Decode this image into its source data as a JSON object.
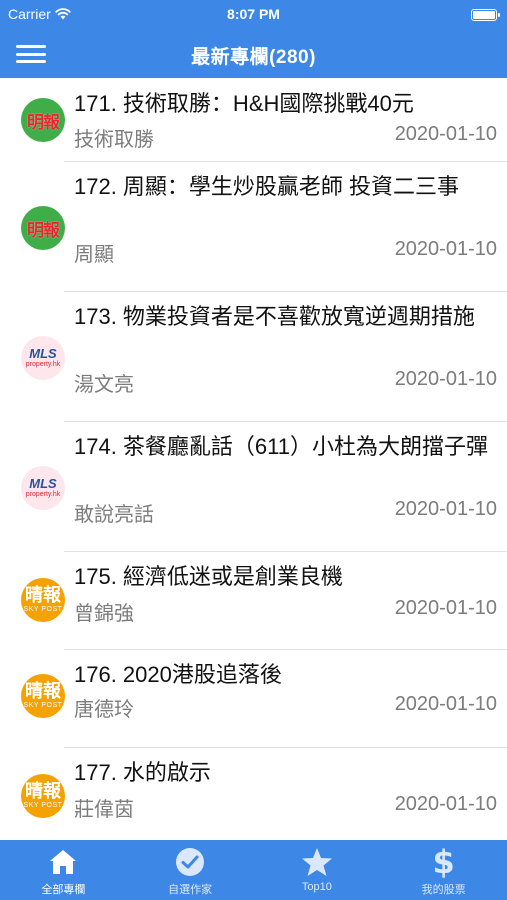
{
  "status_bar": {
    "carrier": "Carrier",
    "time": "8:07 PM"
  },
  "nav": {
    "title": "最新專欄(280)"
  },
  "articles": [
    {
      "logo": "mingpao",
      "logo_text": "明報",
      "headline": "171. 技術取勝：H&H國際挑戰40元",
      "author": "技術取勝",
      "date": "2020-01-10"
    },
    {
      "logo": "mingpao",
      "logo_text": "明報",
      "headline": "172. 周顯：學生炒股贏老師 投資二三事",
      "author": "周顯",
      "date": "2020-01-10"
    },
    {
      "logo": "mls",
      "logo_text": "MLS",
      "logo_sub": "property.hk",
      "headline": "173. 物業投資者是不喜歡放寬逆週期措施",
      "author": "湯文亮",
      "date": "2020-01-10"
    },
    {
      "logo": "mls",
      "logo_text": "MLS",
      "logo_sub": "property.hk",
      "headline": "174. 茶餐廳亂話（611）小杜為大朗擋子彈",
      "author": "敢說亮話",
      "date": "2020-01-10"
    },
    {
      "logo": "skypost",
      "logo_text": "晴報",
      "logo_sub": "SKY POST",
      "headline": "175. 經濟低迷或是創業良機",
      "author": "曾錦強",
      "date": "2020-01-10"
    },
    {
      "logo": "skypost",
      "logo_text": "晴報",
      "logo_sub": "SKY POST",
      "headline": "176. 2020港股追落後",
      "author": "唐德玲",
      "date": "2020-01-10"
    },
    {
      "logo": "skypost",
      "logo_text": "晴報",
      "logo_sub": "SKY POST",
      "headline": "177. 水的啟示",
      "author": "莊偉茵",
      "date": "2020-01-10"
    }
  ],
  "tabs": [
    {
      "label": "全部專欄",
      "icon": "home-icon",
      "active": true
    },
    {
      "label": "自選作家",
      "icon": "checkmark-circle-icon",
      "active": false
    },
    {
      "label": "Top10",
      "icon": "star-icon",
      "active": false
    },
    {
      "label": "我的股票",
      "icon": "dollar-icon",
      "active": false
    }
  ],
  "colors": {
    "primary": "#3d87e6",
    "author_gray": "#7c7c7c"
  }
}
